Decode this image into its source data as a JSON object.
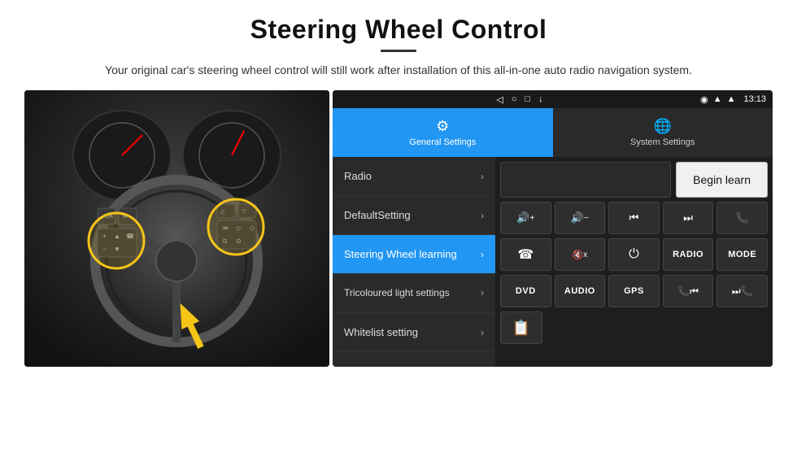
{
  "header": {
    "title": "Steering Wheel Control",
    "subtitle": "Your original car's steering wheel control will still work after installation of this all-in-one auto radio navigation system."
  },
  "status_bar": {
    "time": "13:13",
    "nav_triangle": "◁",
    "nav_circle": "○",
    "nav_square": "□",
    "nav_download": "↓"
  },
  "tabs": {
    "general": {
      "label": "General Settings",
      "icon": "⚙"
    },
    "system": {
      "label": "System Settings",
      "icon": "🌐"
    }
  },
  "menu_items": [
    {
      "label": "Radio",
      "active": false
    },
    {
      "label": "DefaultSetting",
      "active": false
    },
    {
      "label": "Steering Wheel learning",
      "active": true
    },
    {
      "label": "Tricoloured light settings",
      "active": false
    },
    {
      "label": "Whitelist setting",
      "active": false
    }
  ],
  "controls": {
    "begin_learn_label": "Begin learn",
    "row1": [
      "🔊+",
      "🔊−",
      "⏮",
      "⏭",
      "📞"
    ],
    "row2": [
      "☎",
      "🔇",
      "⏻",
      "RADIO",
      "MODE"
    ],
    "row3": [
      "DVD",
      "AUDIO",
      "GPS",
      "📞⏮",
      "⏭📞"
    ],
    "bottom": [
      "📋"
    ]
  }
}
